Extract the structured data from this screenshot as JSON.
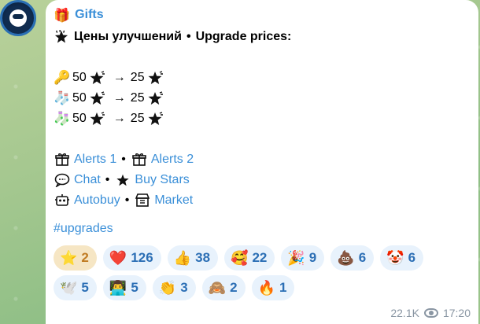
{
  "channel": {
    "name": "Gifts",
    "avatar": "channel-avatar"
  },
  "message": {
    "headline": {
      "ru": "Цены улучшений",
      "sep": "•",
      "en": "Upgrade prices:"
    },
    "prices": [
      {
        "icon": "key-emoji",
        "glyph": "🔑",
        "from": "50",
        "arrow": "→",
        "to": "25"
      },
      {
        "icon": "socks-emoji",
        "glyph": "🧦",
        "from": "50",
        "arrow": "→",
        "to": "25"
      },
      {
        "icon": "sock-pink-emoji",
        "glyph": "🧦",
        "from": "50",
        "arrow": "→",
        "to": "25"
      }
    ],
    "links": {
      "alerts1": "Alerts 1",
      "alerts2": "Alerts 2",
      "chat": "Chat",
      "buy_stars": "Buy Stars",
      "autobuy": "Autobuy",
      "market": "Market",
      "sep": "•"
    },
    "hashtag": "#upgrades"
  },
  "reactions": [
    {
      "emoji": "⭐",
      "count": "2",
      "icon": "star-icon",
      "chosen": true
    },
    {
      "emoji": "❤️",
      "count": "126",
      "icon": "heart-icon"
    },
    {
      "emoji": "👍",
      "count": "38",
      "icon": "thumbs-up-icon"
    },
    {
      "emoji": "🥰",
      "count": "22",
      "icon": "smiling-hearts-icon"
    },
    {
      "emoji": "🎉",
      "count": "9",
      "icon": "party-popper-icon"
    },
    {
      "emoji": "💩",
      "count": "6",
      "icon": "poop-icon"
    },
    {
      "emoji": "🤡",
      "count": "6",
      "icon": "clown-icon"
    },
    {
      "emoji": "🕊️",
      "count": "5",
      "icon": "dove-icon"
    },
    {
      "emoji": "👨‍💻",
      "count": "5",
      "icon": "technologist-icon"
    },
    {
      "emoji": "👏",
      "count": "3",
      "icon": "clapping-icon"
    },
    {
      "emoji": "🙈",
      "count": "2",
      "icon": "see-no-evil-icon"
    },
    {
      "emoji": "🔥",
      "count": "1",
      "icon": "fire-icon"
    }
  ],
  "meta": {
    "views": "22.1K",
    "time": "17:20"
  },
  "colors": {
    "link": "#3a8fd8",
    "reaction_bg": "#e8f2fc",
    "reaction_chosen_bg": "#f6e6c4"
  }
}
